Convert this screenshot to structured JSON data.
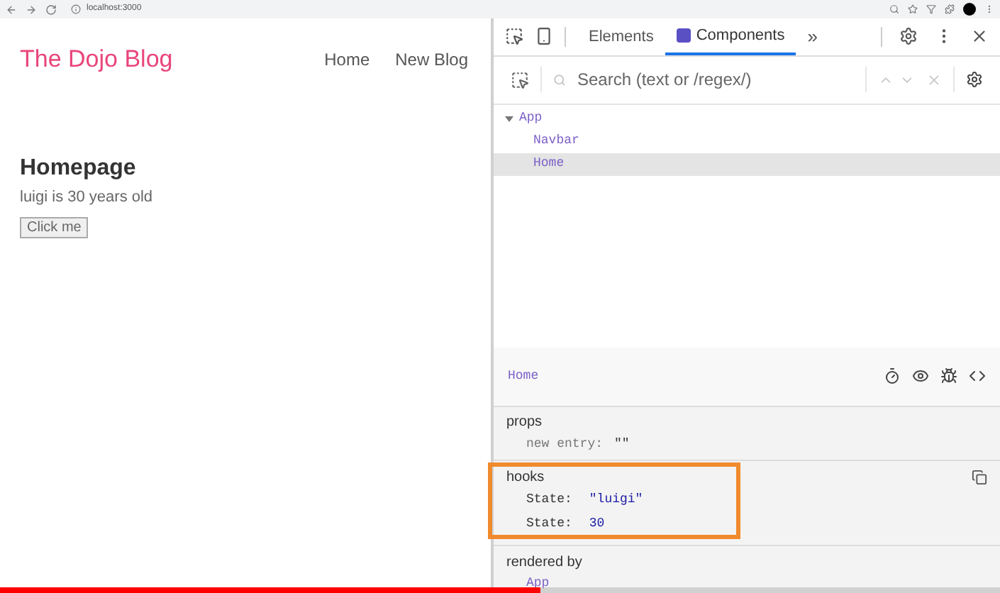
{
  "browser": {
    "url": "localhost:3000"
  },
  "page": {
    "brand": "The Dojo Blog",
    "nav": [
      "Home",
      "New Blog"
    ],
    "heading": "Homepage",
    "text": "luigi is 30 years old",
    "button": "Click me"
  },
  "devtools": {
    "tabs": [
      {
        "label": "Elements",
        "selected": false
      },
      {
        "label": "Components",
        "selected": true
      }
    ],
    "more": "»",
    "search": {
      "placeholder": "Search (text or /regex/)"
    },
    "tree": [
      {
        "name": "App",
        "expanded": true,
        "selected": false,
        "children": [
          {
            "name": "Navbar",
            "selected": false
          },
          {
            "name": "Home",
            "selected": true
          }
        ]
      }
    ],
    "inspected": "Home",
    "props": {
      "title": "props",
      "rows": [
        {
          "key": "new entry:",
          "value": "\"\""
        }
      ]
    },
    "hooks": {
      "title": "hooks",
      "highlighted": true,
      "rows": [
        {
          "key": "State:",
          "value": "\"luigi\""
        },
        {
          "key": "State:",
          "value": "30"
        }
      ]
    },
    "rendered_by": {
      "title": "rendered by",
      "items": [
        "App"
      ]
    }
  },
  "video_progress": {
    "level": 0.54
  }
}
